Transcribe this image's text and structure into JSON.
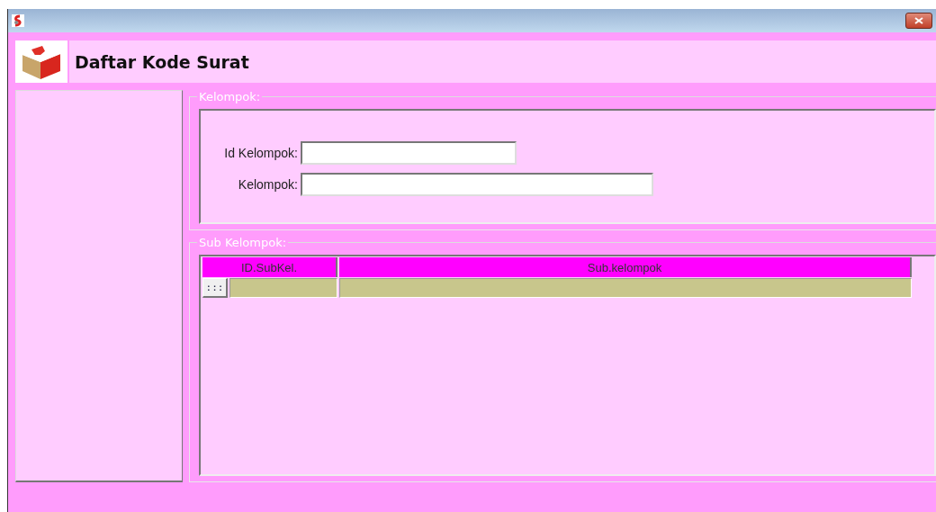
{
  "header": {
    "title": "Daftar Kode Surat"
  },
  "kelompok": {
    "legend": "Kelompok:",
    "fields": [
      {
        "label": "Id Kelompok:"
      },
      {
        "label": "Kelompok:"
      }
    ]
  },
  "sub_kelompok": {
    "legend": "Sub Kelompok:",
    "table": {
      "columns": [
        "ID.SubKel.",
        "Sub.kelompok"
      ],
      "rows": [
        {
          "selector": ":::"
        }
      ]
    }
  }
}
